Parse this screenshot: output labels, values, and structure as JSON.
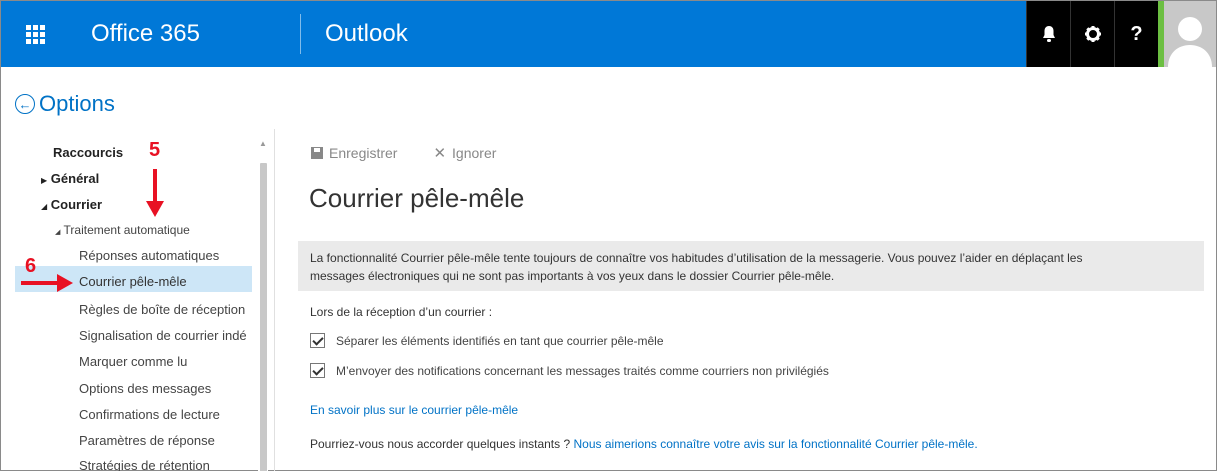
{
  "header": {
    "brand": "Office 365",
    "app": "Outlook",
    "icons": [
      "bell-icon",
      "gear-icon",
      "help-icon"
    ],
    "help_label": "?",
    "accent_color": "#0078d7"
  },
  "options": {
    "title": "Options"
  },
  "nav": {
    "shortcuts": "Raccourcis",
    "general": "Général",
    "mail": "Courrier",
    "auto_processing": "Traitement automatique",
    "items": [
      "Réponses automatiques",
      "Courrier pêle-mêle",
      "Règles de boîte de réception",
      "Signalisation de courrier indé",
      "Marquer comme lu",
      "Options des messages",
      "Confirmations de lecture",
      "Paramètres de réponse",
      "Stratégies de rétention"
    ],
    "selected_index": 1
  },
  "annotations": {
    "step5": "5",
    "step6": "6",
    "color": "#e81123"
  },
  "toolbar": {
    "save": "Enregistrer",
    "discard": "Ignorer"
  },
  "main": {
    "title": "Courrier pêle-mêle",
    "info_line1": "La fonctionnalité Courrier pêle-mêle tente toujours de connaître vos habitudes d’utilisation de la messagerie. Vous pouvez l’aider en déplaçant les",
    "info_line2": "messages électroniques qui ne sont pas importants à vos yeux dans le dossier Courrier pêle-mêle.",
    "on_receive": "Lors de la réception d’un courrier :",
    "option1": "Séparer les éléments identifiés en tant que courrier pêle-mêle",
    "option2": "M’envoyer des notifications concernant les messages traités comme courriers non privilégiés",
    "learn_more": "En savoir plus sur le courrier pêle-mêle",
    "feedback_prefix": "Pourriez-vous nous accorder quelques instants ?",
    "feedback_link": "Nous aimerions connaître votre avis sur la fonctionnalité Courrier pêle-mêle."
  }
}
